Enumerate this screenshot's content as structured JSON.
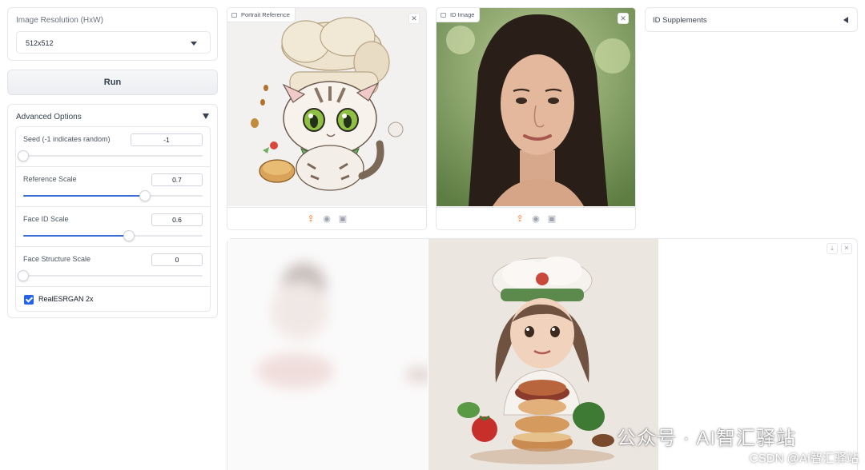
{
  "resolution": {
    "label": "Image Resolution (HxW)",
    "value": "512x512"
  },
  "run_label": "Run",
  "advanced": {
    "title": "Advanced Options",
    "seed": {
      "label": "Seed (-1 indicates random)",
      "value": "-1",
      "fraction": 0.0
    },
    "reference_scale": {
      "label": "Reference Scale",
      "value": "0.7",
      "fraction": 0.68
    },
    "face_id_scale": {
      "label": "Face ID Scale",
      "value": "0.6",
      "fraction": 0.59
    },
    "face_structure_scale": {
      "label": "Face Structure Scale",
      "value": "0",
      "fraction": 0.0
    },
    "realesrgan": {
      "label": "RealESRGAN 2x",
      "checked": true
    }
  },
  "portrait": {
    "label": "Portrait Reference"
  },
  "id_image": {
    "label": "ID Image"
  },
  "id_supplements": {
    "label": "ID Supplements"
  },
  "watermark": "公众号 · AI智汇驿站",
  "csdn": "CSDN @AI智汇驿站",
  "colors": {
    "accent": "#3b6fd8",
    "checkbox": "#2563eb",
    "upload": "#f97316"
  }
}
